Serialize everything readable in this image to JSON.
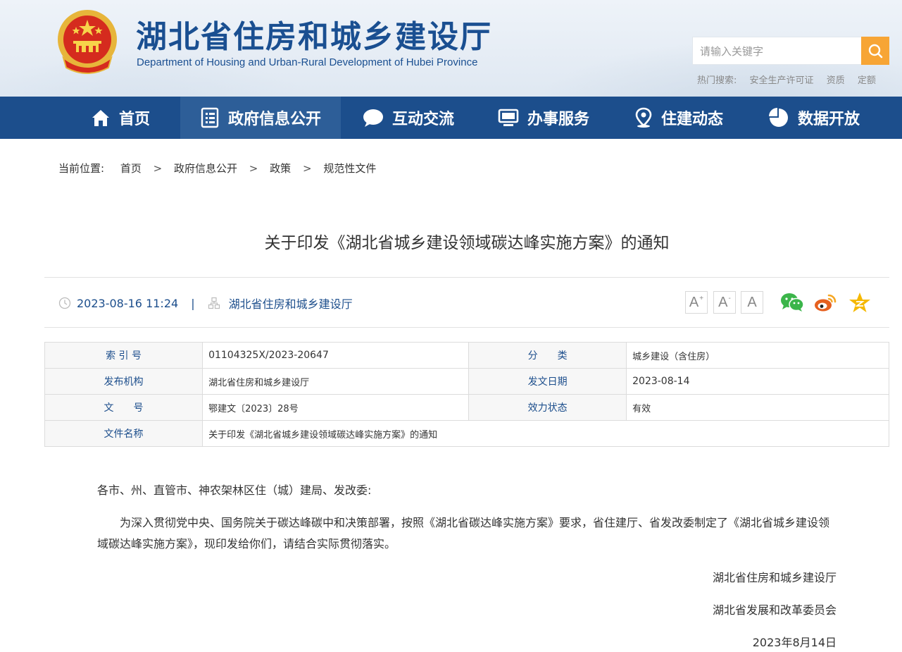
{
  "header": {
    "title_cn": "湖北省住房和城乡建设厅",
    "title_en": "Department of Housing and Urban-Rural Development of Hubei Province",
    "search_placeholder": "请输入关键字",
    "hot_label": "热门搜索:",
    "hot_items": [
      "安全生产许可证",
      "资质",
      "定额"
    ]
  },
  "nav": {
    "items": [
      {
        "label": "首页",
        "icon": "home-icon"
      },
      {
        "label": "政府信息公开",
        "icon": "document-list-icon",
        "active": true
      },
      {
        "label": "互动交流",
        "icon": "chat-bubble-icon"
      },
      {
        "label": "办事服务",
        "icon": "monitor-icon"
      },
      {
        "label": "住建动态",
        "icon": "location-pin-icon"
      },
      {
        "label": "数据开放",
        "icon": "pie-chart-icon"
      }
    ]
  },
  "breadcrumb": {
    "prefix": "当前位置:",
    "items": [
      "首页",
      "政府信息公开",
      "政策",
      "规范性文件"
    ],
    "separator": ">"
  },
  "article": {
    "title": "关于印发《湖北省城乡建设领域碳达峰实施方案》的通知",
    "publish_time": "2023-08-16 11:24",
    "meta_separator": "|",
    "source": "湖北省住房和城乡建设厅",
    "font_sizes": [
      "A",
      "A",
      "A"
    ]
  },
  "info_table": {
    "index_label": "索 引 号",
    "index_value": "01104325X/2023-20647",
    "category_label": "分　　类",
    "category_value": "城乡建设（含住房）",
    "issuer_label": "发布机构",
    "issuer_value": "湖北省住房和城乡建设厅",
    "date_label": "发文日期",
    "date_value": "2023-08-14",
    "doc_no_label": "文　　号",
    "doc_no_value": "鄂建文〔2023〕28号",
    "status_label": "效力状态",
    "status_value": "有效",
    "name_label": "文件名称",
    "name_value": "关于印发《湖北省城乡建设领域碳达峰实施方案》的通知"
  },
  "body": {
    "greeting": "各市、州、直管市、神农架林区住（城）建局、发改委:",
    "paragraph": "为深入贯彻党中央、国务院关于碳达峰碳中和决策部署，按照《湖北省碳达峰实施方案》要求，省住建厅、省发改委制定了《湖北省城乡建设领域碳达峰实施方案》，现印发给你们，请结合实际贯彻落实。",
    "sign1": "湖北省住房和城乡建设厅",
    "sign2": "湖北省发展和改革委员会",
    "sign_date": "2023年8月14日"
  },
  "colors": {
    "nav_bg": "#1c4e8c",
    "nav_active": "#2d5e98",
    "title_blue": "#1a4f91",
    "search_orange": "#f7a535",
    "wechat_green": "#3bb54a",
    "weibo_orange": "#e6601f",
    "favorite_yellow": "#f5b800"
  }
}
